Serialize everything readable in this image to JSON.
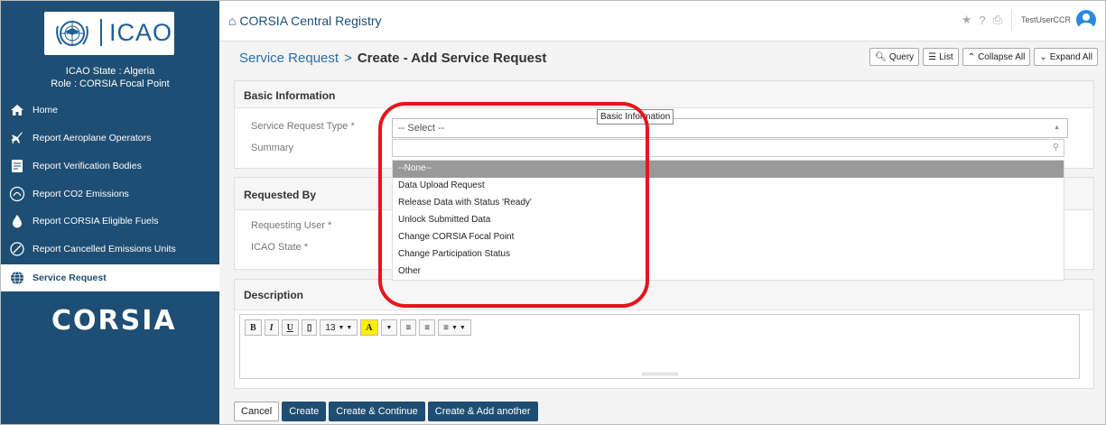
{
  "sidebar": {
    "logo_text": "ICAO",
    "state_line": "ICAO State : Algeria",
    "role_line": "Role : CORSIA Focal Point",
    "items": [
      {
        "label": "Home",
        "icon": "home-icon"
      },
      {
        "label": "Report Aeroplane Operators",
        "icon": "plane-icon"
      },
      {
        "label": "Report Verification Bodies",
        "icon": "document-icon"
      },
      {
        "label": "Report CO2 Emissions",
        "icon": "co2-icon"
      },
      {
        "label": "Report CORSIA Eligible Fuels",
        "icon": "fuel-drop-icon"
      },
      {
        "label": "Report Cancelled Emissions Units",
        "icon": "cancel-circle-icon"
      },
      {
        "label": "Service Request",
        "icon": "globe-icon"
      }
    ],
    "corsia_logo": "CORSIA"
  },
  "topbar": {
    "title": "CORSIA Central Registry",
    "username": "TestUserCCR"
  },
  "breadcrumb": {
    "parent": "Service Request",
    "separator": ">",
    "current": "Create - Add Service Request"
  },
  "toolbar": {
    "query": "Query",
    "list": "List",
    "collapse_all": "Collapse All",
    "expand_all": "Expand All"
  },
  "basic_info": {
    "heading": "Basic Information",
    "type_label": "Service Request Type *",
    "summary_label": "Summary",
    "select_value": "-- Select --",
    "tooltip": "Basic Information",
    "options": [
      "--None--",
      "Data Upload Request",
      "Release Data with Status 'Ready'",
      "Unlock Submitted Data",
      "Change CORSIA Focal Point",
      "Change Participation Status",
      "Other"
    ]
  },
  "requested_by": {
    "heading": "Requested By",
    "user_label": "Requesting User *",
    "state_label": "ICAO State *"
  },
  "description": {
    "heading": "Description",
    "font_size": "13"
  },
  "buttons": {
    "cancel": "Cancel",
    "create": "Create",
    "create_continue": "Create & Continue",
    "create_add": "Create & Add another"
  },
  "colors": {
    "sidebar": "#1e4e73",
    "highlight_ring": "#e4161b",
    "link": "#2a6fa8"
  }
}
